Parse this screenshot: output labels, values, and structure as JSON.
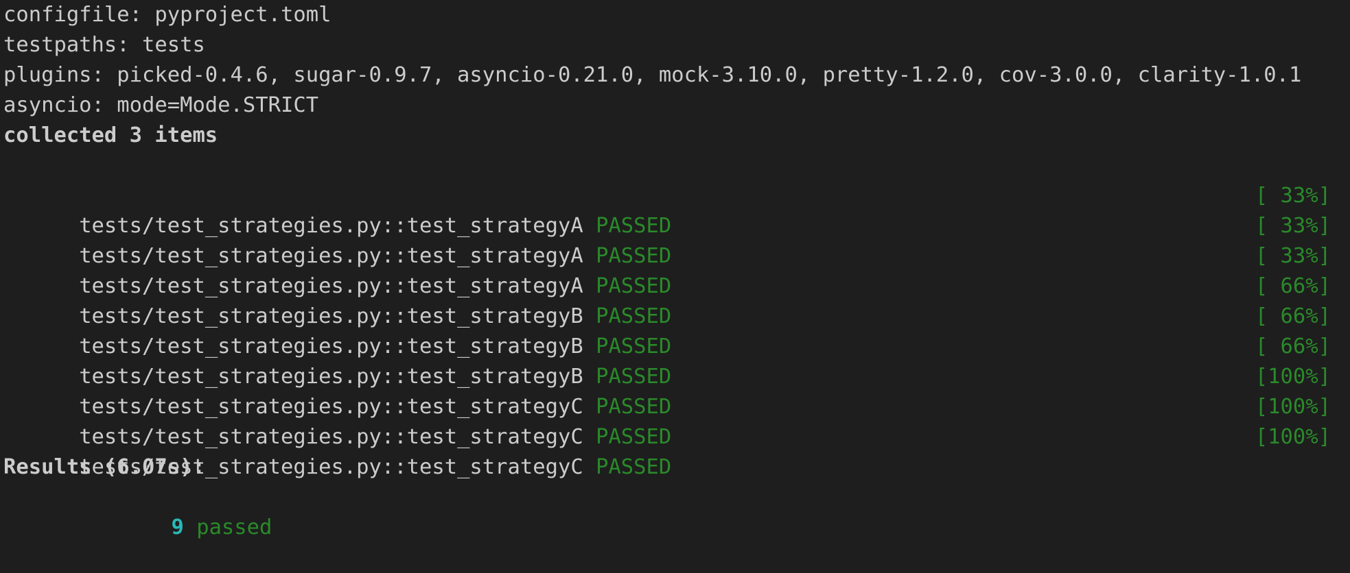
{
  "header": {
    "configfile": "configfile: pyproject.toml",
    "testpaths": "testpaths: tests",
    "plugins": "plugins: picked-0.4.6, sugar-0.9.7, asyncio-0.21.0, mock-3.10.0, pretty-1.2.0, cov-3.0.0, clarity-1.0.1",
    "asyncio": "asyncio: mode=Mode.STRICT",
    "collected": "collected 3 items"
  },
  "tests": [
    {
      "name": "tests/test_strategies.py::test_strategyA",
      "status": "PASSED",
      "percent": "[ 33%]"
    },
    {
      "name": "tests/test_strategies.py::test_strategyA",
      "status": "PASSED",
      "percent": "[ 33%]"
    },
    {
      "name": "tests/test_strategies.py::test_strategyA",
      "status": "PASSED",
      "percent": "[ 33%]"
    },
    {
      "name": "tests/test_strategies.py::test_strategyB",
      "status": "PASSED",
      "percent": "[ 66%]"
    },
    {
      "name": "tests/test_strategies.py::test_strategyB",
      "status": "PASSED",
      "percent": "[ 66%]"
    },
    {
      "name": "tests/test_strategies.py::test_strategyB",
      "status": "PASSED",
      "percent": "[ 66%]"
    },
    {
      "name": "tests/test_strategies.py::test_strategyC",
      "status": "PASSED",
      "percent": "[100%]"
    },
    {
      "name": "tests/test_strategies.py::test_strategyC",
      "status": "PASSED",
      "percent": "[100%]"
    },
    {
      "name": "tests/test_strategies.py::test_strategyC",
      "status": "PASSED",
      "percent": "[100%]"
    }
  ],
  "results": {
    "title": "Results (6.07s):",
    "count": "9",
    "label": "passed"
  },
  "colors": {
    "background": "#1e1e1e",
    "text": "#cccccc",
    "passed": "#2a8a2a",
    "count": "#29b8b8"
  }
}
